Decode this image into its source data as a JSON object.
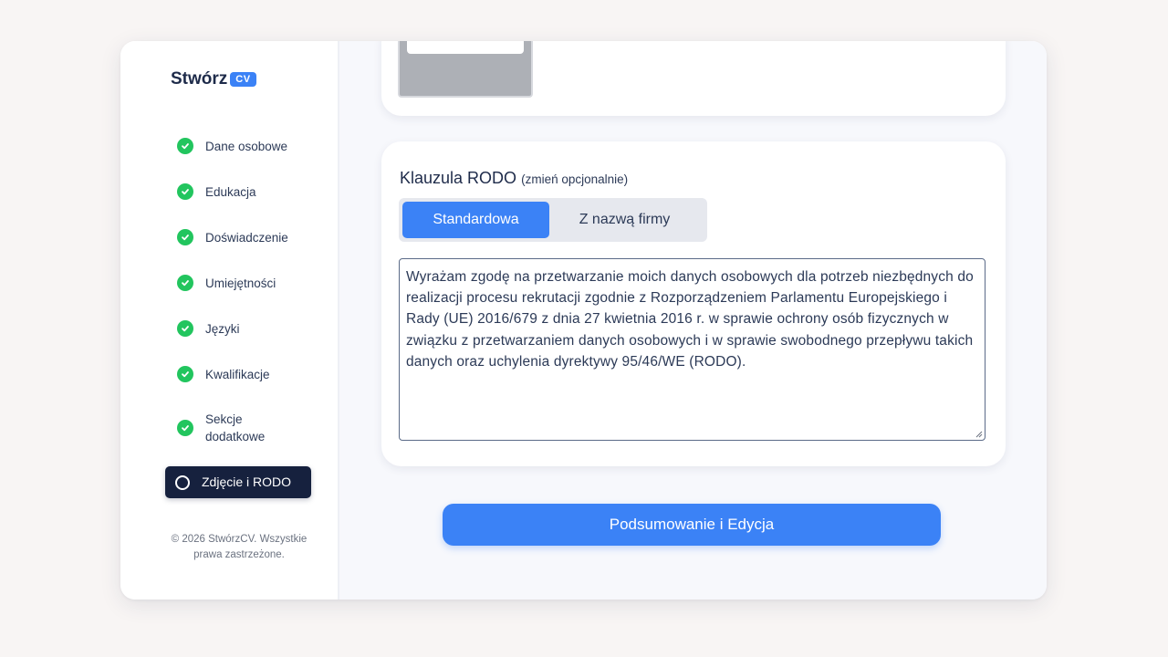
{
  "logo": {
    "text": "Stwórz",
    "badge": "CV"
  },
  "steps": [
    {
      "label": "Dane osobowe",
      "done": true
    },
    {
      "label": "Edukacja",
      "done": true
    },
    {
      "label": "Doświadczenie",
      "done": true
    },
    {
      "label": "Umiejętności",
      "done": true
    },
    {
      "label": "Języki",
      "done": true
    },
    {
      "label": "Kwalifikacje",
      "done": true
    },
    {
      "label": "Sekcje dodatkowe",
      "done": true
    }
  ],
  "active_step": {
    "label": "Zdjęcie i RODO"
  },
  "footer": {
    "text": "© 2026 StwórzCV. Wszystkie prawa zastrzeżone."
  },
  "rodo": {
    "title": "Klauzula RODO",
    "optional_note": "(zmień opcjonalnie)",
    "tabs": [
      {
        "label": "Standardowa",
        "selected": true
      },
      {
        "label": "Z nazwą firmy",
        "selected": false
      }
    ],
    "clause_text": "Wyrażam zgodę na przetwarzanie moich danych osobowych dla potrzeb niezbędnych do realizacji procesu rekrutacji zgodnie z Rozporządzeniem Parlamentu Europejskiego i Rady (UE) 2016/679 z dnia 27 kwietnia 2016 r. w sprawie ochrony osób fizycznych w związku z przetwarzaniem danych osobowych i w sprawie swobodnego przepływu takich danych oraz uchylenia dyrektywy 95/46/WE (RODO)."
  },
  "cta": {
    "label": "Podsumowanie i Edycja"
  },
  "colors": {
    "accent": "#3b82f6",
    "success": "#22c55e",
    "active_bg": "#16213e",
    "text": "#1e2b4a"
  }
}
